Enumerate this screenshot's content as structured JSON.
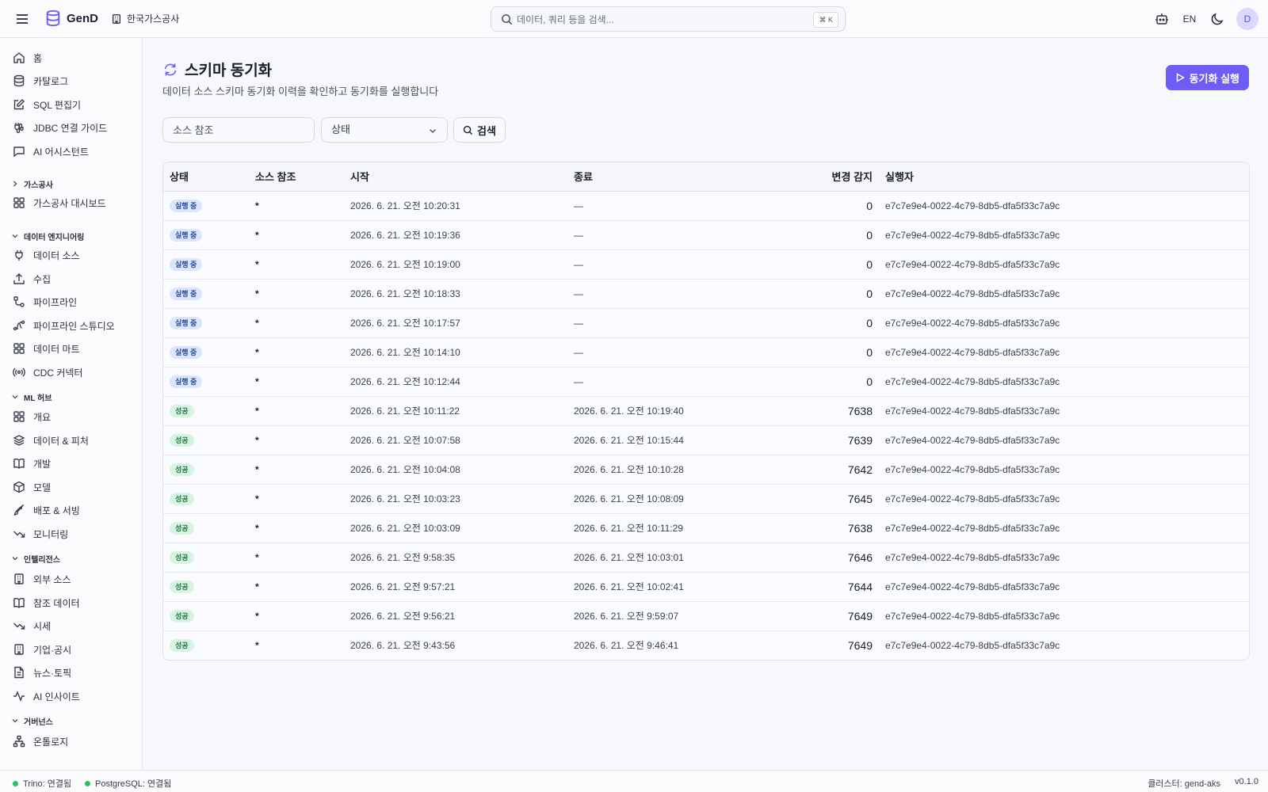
{
  "app": {
    "name": "GenD",
    "org": "한국가스공사"
  },
  "search": {
    "placeholder": "데이터, 쿼리 등을 검색...",
    "shortcut": "⌘ K"
  },
  "topbar": {
    "lang": "EN",
    "avatar": "D"
  },
  "sidebar": {
    "main_items": [
      {
        "label": "홈",
        "icon": "home-icon"
      },
      {
        "label": "카탈로그",
        "icon": "database-icon"
      },
      {
        "label": "SQL 편집기",
        "icon": "edit-icon"
      },
      {
        "label": "JDBC 연결 가이드",
        "icon": "cable-icon"
      },
      {
        "label": "AI 어시스턴트",
        "icon": "chat-icon"
      }
    ],
    "groups": [
      {
        "title": "가스공사",
        "collapsed": true,
        "items": [
          {
            "label": "가스공사 대시보드",
            "icon": "grid-icon"
          }
        ]
      },
      {
        "title": "데이터 엔지니어링",
        "items": [
          {
            "label": "데이터 소스",
            "icon": "plug-icon"
          },
          {
            "label": "수집",
            "icon": "upload-icon"
          },
          {
            "label": "파이프라인",
            "icon": "pipeline-icon"
          },
          {
            "label": "파이프라인 스튜디오",
            "icon": "workflow-icon"
          },
          {
            "label": "데이터 마트",
            "icon": "grid-icon"
          },
          {
            "label": "CDC 커넥터",
            "icon": "radio-icon"
          }
        ]
      },
      {
        "title": "ML 허브",
        "items": [
          {
            "label": "개요",
            "icon": "grid-icon"
          },
          {
            "label": "데이터 & 피처",
            "icon": "layers-icon"
          },
          {
            "label": "개발",
            "icon": "book-icon"
          },
          {
            "label": "모델",
            "icon": "box-icon"
          },
          {
            "label": "배포 & 서빙",
            "icon": "rocket-icon"
          },
          {
            "label": "모니터링",
            "icon": "trend-icon"
          }
        ]
      },
      {
        "title": "인텔리전스",
        "items": [
          {
            "label": "외부 소스",
            "icon": "building-icon"
          },
          {
            "label": "참조 데이터",
            "icon": "book-icon"
          },
          {
            "label": "시세",
            "icon": "trend-icon"
          },
          {
            "label": "기업·공시",
            "icon": "building-icon"
          },
          {
            "label": "뉴스·토픽",
            "icon": "file-icon"
          },
          {
            "label": "AI 인사이트",
            "icon": "activity-icon"
          }
        ]
      },
      {
        "title": "거버넌스",
        "items": [
          {
            "label": "온톨로지",
            "icon": "network-icon"
          }
        ]
      }
    ]
  },
  "page": {
    "title": "스키마 동기화",
    "subtitle": "데이터 소스 스키마 동기화 이력을 확인하고 동기화를 실행합니다",
    "run_button": "동기화 실행"
  },
  "filters": {
    "source_placeholder": "소스 참조",
    "status_label": "상태",
    "search_button": "검색"
  },
  "table": {
    "columns": [
      "상태",
      "소스 참조",
      "시작",
      "종료",
      "변경 감지",
      "실행자"
    ],
    "rows": [
      {
        "status": "실행 중",
        "status_kind": "running",
        "ref": "*",
        "start": "2026. 6. 21. 오전 10:20:31",
        "end": "—",
        "changes": "0",
        "runner": "e7c7e9e4-0022-4c79-8db5-dfa5f33c7a9c"
      },
      {
        "status": "실행 중",
        "status_kind": "running",
        "ref": "*",
        "start": "2026. 6. 21. 오전 10:19:36",
        "end": "—",
        "changes": "0",
        "runner": "e7c7e9e4-0022-4c79-8db5-dfa5f33c7a9c"
      },
      {
        "status": "실행 중",
        "status_kind": "running",
        "ref": "*",
        "start": "2026. 6. 21. 오전 10:19:00",
        "end": "—",
        "changes": "0",
        "runner": "e7c7e9e4-0022-4c79-8db5-dfa5f33c7a9c"
      },
      {
        "status": "실행 중",
        "status_kind": "running",
        "ref": "*",
        "start": "2026. 6. 21. 오전 10:18:33",
        "end": "—",
        "changes": "0",
        "runner": "e7c7e9e4-0022-4c79-8db5-dfa5f33c7a9c"
      },
      {
        "status": "실행 중",
        "status_kind": "running",
        "ref": "*",
        "start": "2026. 6. 21. 오전 10:17:57",
        "end": "—",
        "changes": "0",
        "runner": "e7c7e9e4-0022-4c79-8db5-dfa5f33c7a9c"
      },
      {
        "status": "실행 중",
        "status_kind": "running",
        "ref": "*",
        "start": "2026. 6. 21. 오전 10:14:10",
        "end": "—",
        "changes": "0",
        "runner": "e7c7e9e4-0022-4c79-8db5-dfa5f33c7a9c"
      },
      {
        "status": "실행 중",
        "status_kind": "running",
        "ref": "*",
        "start": "2026. 6. 21. 오전 10:12:44",
        "end": "—",
        "changes": "0",
        "runner": "e7c7e9e4-0022-4c79-8db5-dfa5f33c7a9c"
      },
      {
        "status": "성공",
        "status_kind": "success",
        "ref": "*",
        "start": "2026. 6. 21. 오전 10:11:22",
        "end": "2026. 6. 21. 오전 10:19:40",
        "changes": "7638",
        "runner": "e7c7e9e4-0022-4c79-8db5-dfa5f33c7a9c"
      },
      {
        "status": "성공",
        "status_kind": "success",
        "ref": "*",
        "start": "2026. 6. 21. 오전 10:07:58",
        "end": "2026. 6. 21. 오전 10:15:44",
        "changes": "7639",
        "runner": "e7c7e9e4-0022-4c79-8db5-dfa5f33c7a9c"
      },
      {
        "status": "성공",
        "status_kind": "success",
        "ref": "*",
        "start": "2026. 6. 21. 오전 10:04:08",
        "end": "2026. 6. 21. 오전 10:10:28",
        "changes": "7642",
        "runner": "e7c7e9e4-0022-4c79-8db5-dfa5f33c7a9c"
      },
      {
        "status": "성공",
        "status_kind": "success",
        "ref": "*",
        "start": "2026. 6. 21. 오전 10:03:23",
        "end": "2026. 6. 21. 오전 10:08:09",
        "changes": "7645",
        "runner": "e7c7e9e4-0022-4c79-8db5-dfa5f33c7a9c"
      },
      {
        "status": "성공",
        "status_kind": "success",
        "ref": "*",
        "start": "2026. 6. 21. 오전 10:03:09",
        "end": "2026. 6. 21. 오전 10:11:29",
        "changes": "7638",
        "runner": "e7c7e9e4-0022-4c79-8db5-dfa5f33c7a9c"
      },
      {
        "status": "성공",
        "status_kind": "success",
        "ref": "*",
        "start": "2026. 6. 21. 오전 9:58:35",
        "end": "2026. 6. 21. 오전 10:03:01",
        "changes": "7646",
        "runner": "e7c7e9e4-0022-4c79-8db5-dfa5f33c7a9c"
      },
      {
        "status": "성공",
        "status_kind": "success",
        "ref": "*",
        "start": "2026. 6. 21. 오전 9:57:21",
        "end": "2026. 6. 21. 오전 10:02:41",
        "changes": "7644",
        "runner": "e7c7e9e4-0022-4c79-8db5-dfa5f33c7a9c"
      },
      {
        "status": "성공",
        "status_kind": "success",
        "ref": "*",
        "start": "2026. 6. 21. 오전 9:56:21",
        "end": "2026. 6. 21. 오전 9:59:07",
        "changes": "7649",
        "runner": "e7c7e9e4-0022-4c79-8db5-dfa5f33c7a9c"
      },
      {
        "status": "성공",
        "status_kind": "success",
        "ref": "*",
        "start": "2026. 6. 21. 오전 9:43:56",
        "end": "2026. 6. 21. 오전 9:46:41",
        "changes": "7649",
        "runner": "e7c7e9e4-0022-4c79-8db5-dfa5f33c7a9c"
      }
    ]
  },
  "footer": {
    "trino": "Trino: 연결됨",
    "postgres": "PostgreSQL: 연결됨",
    "cluster": "클러스터: gend-aks",
    "version": "v0.1.0"
  },
  "colors": {
    "accent": "#6d5cf6",
    "running_badge": "#dbe6fb",
    "success_badge": "#d9f3e2",
    "connected": "#22c55e"
  }
}
